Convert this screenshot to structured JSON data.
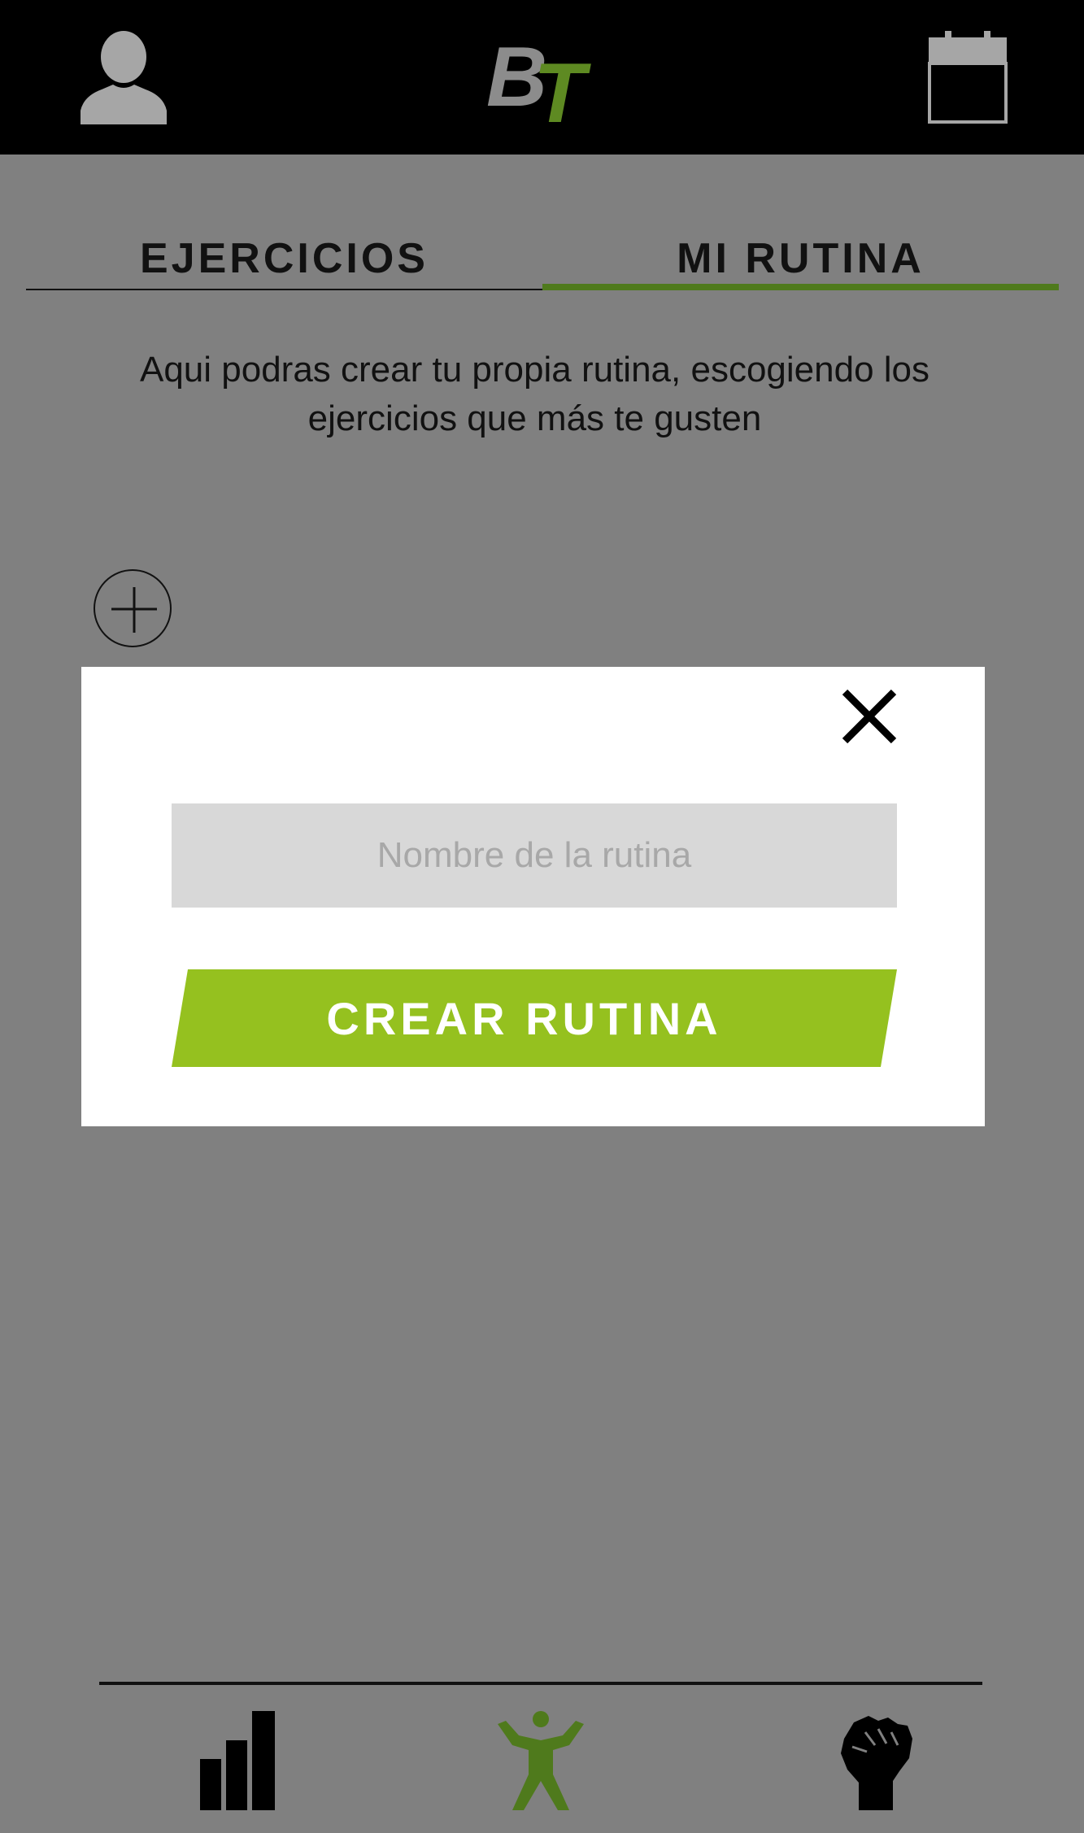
{
  "header": {
    "logo_text": "BT",
    "profile_icon": "user-icon",
    "calendar_icon": "calendar-icon"
  },
  "tabs": [
    {
      "label": "EJERCICIOS",
      "active": false
    },
    {
      "label": "MI RUTINA",
      "active": true
    }
  ],
  "intro_text": "Aqui podras crear tu propia rutina, escogiendo los ejercicios que más te gusten",
  "add_icon": "plus-circle-icon",
  "modal": {
    "input_value": "",
    "input_placeholder": "Nombre de la rutina",
    "create_button_label": "CREAR RUTINA",
    "close_icon": "close-icon"
  },
  "bottom_nav": [
    {
      "icon": "bar-chart-icon"
    },
    {
      "icon": "person-exercise-icon"
    },
    {
      "icon": "fist-icon"
    }
  ],
  "colors": {
    "accent_green": "#95c11f",
    "dark_green": "#4f7a1c",
    "background": "#808080",
    "topbar": "#000000"
  }
}
